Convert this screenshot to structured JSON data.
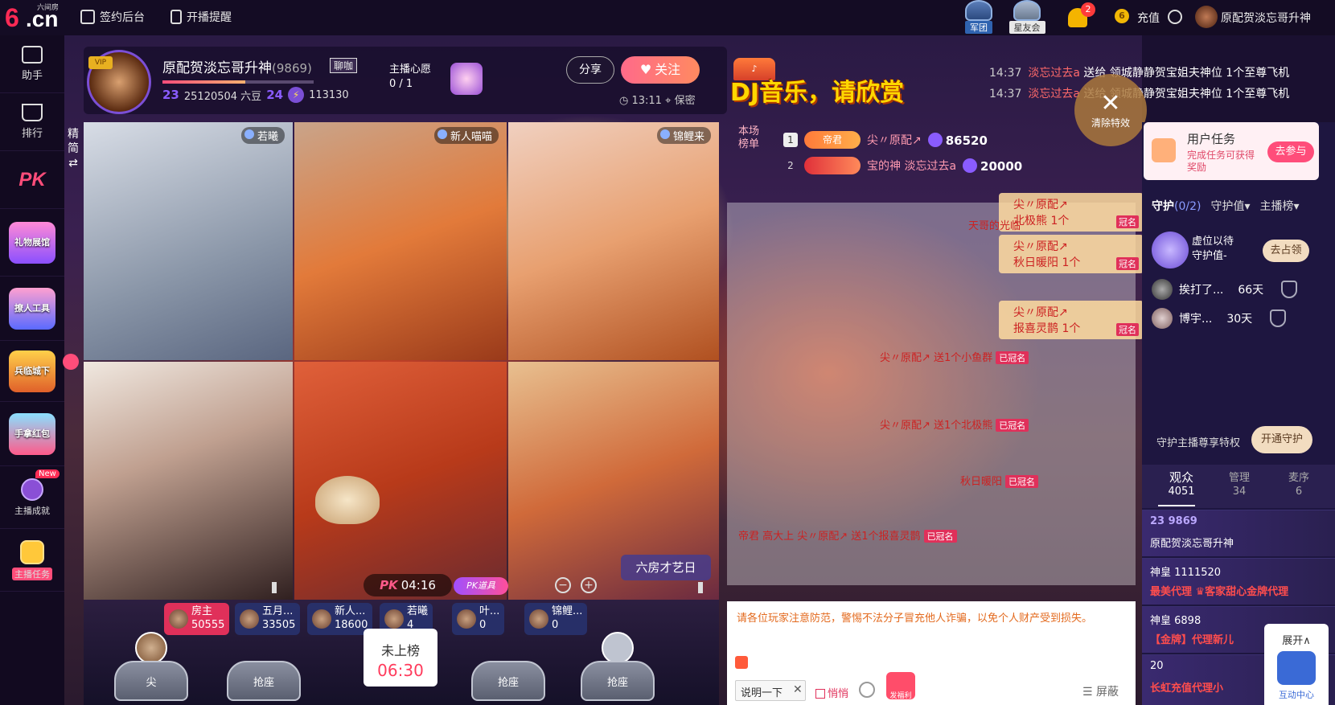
{
  "topbar": {
    "logo_main": "6",
    "logo_cn": ".cn",
    "logo_sub": "六间房",
    "sign_backend": "签约后台",
    "broadcast_reminder": "开播提醒",
    "army": "军团",
    "star_club": "星友会",
    "notification_count": "2",
    "coin_symbol": "6",
    "recharge": "充值",
    "username": "原配贺淡忘哥升神"
  },
  "sidebar": {
    "assistant": "助手",
    "ranking": "排行",
    "pk": "PK",
    "gift_hall": "礼物展馆",
    "tools": "撩人工具",
    "game": "兵临城下",
    "game2": "手拿红包",
    "achievement": "主播成就",
    "achievement_new": "New",
    "task": "主播任务"
  },
  "header": {
    "anchor_name": "原配贺淡忘哥升神",
    "anchor_id": "(9869)",
    "chat_tag": "聊咖",
    "level": "23",
    "beans": "25120504 六豆",
    "level2": "24",
    "points": "113130",
    "level_progress": 0.55,
    "wish_label": "主播心愿",
    "wish_count": "0 / 1",
    "share": "分享",
    "follow": "关注",
    "time": "13:11",
    "privacy": "保密"
  },
  "dj_banner": "DJ音乐，请欣赏",
  "notices": [
    {
      "time": "14:37",
      "user": "淡忘过去a",
      "msg": "送给 领城静静贺宝姐夫神位 1个至尊飞机"
    },
    {
      "time": "14:37",
      "user": "淡忘过去a",
      "msg": "送给 领城静静贺宝姐夫神位 1个至尊飞机"
    }
  ],
  "clear_effects": "清除特效",
  "vertical_tab": "精简",
  "video_cells": [
    {
      "name": "若曦"
    },
    {
      "name": "新人喵喵"
    },
    {
      "name": "锦鲤来"
    }
  ],
  "talent_btn": "六房才艺日",
  "pk_timer_label": "PK",
  "pk_timer": "04:16",
  "pk_tag": "PK道具",
  "ranks": [
    {
      "name": "房主",
      "value": "50555"
    },
    {
      "name": "五月...",
      "value": "33505"
    },
    {
      "name": "新人...",
      "value": "18600"
    },
    {
      "name": "若曦",
      "value": "4"
    },
    {
      "name": "叶...",
      "value": "0"
    },
    {
      "name": "锦鲤...",
      "value": "0"
    }
  ],
  "seats": {
    "seat1": "尖",
    "grab": "抢座",
    "onmic_l1": "未上榜",
    "onmic_l2": "06:30"
  },
  "session_rank": {
    "title": "本场榜单",
    "rows": [
      {
        "num": "1",
        "badge": "帝君",
        "name": "尖〃原配↗",
        "value": "86520"
      },
      {
        "num": "2",
        "badge": "",
        "name": "宝的神 淡忘过去a",
        "value": "20000"
      }
    ]
  },
  "gift_pops": [
    {
      "name": "尖〃原配↗",
      "gift": "北极熊 1个",
      "tag": "冠名"
    },
    {
      "name": "尖〃原配↗",
      "gift": "秋日暖阳 1个",
      "tag": "冠名"
    },
    {
      "name": "尖〃原配↗",
      "gift": "报喜灵鹊 1个",
      "tag": "冠名"
    }
  ],
  "chat_msgs": [
    {
      "text": "天哥的光临"
    },
    {
      "text": "尖〃原配↗ 送1个小鱼群",
      "tag": "已冠名"
    },
    {
      "text": "尖〃原配↗ 送1个北极熊",
      "tag": "已冠名"
    },
    {
      "text": "秋日暖阳",
      "tag": "已冠名"
    },
    {
      "text": "帝君  高大上  尖〃原配↗ 送1个报喜灵鹊",
      "tag": "已冠名"
    }
  ],
  "warning": "请各位玩家注意防范，警惕不法分子冒充他人诈骗，以免个人财产受到损失。",
  "input": {
    "say": "说明一下",
    "whisper": "悄悄",
    "redpack": "发福利",
    "block": "屏蔽"
  },
  "task_card": {
    "title": "用户任务",
    "desc": "完成任务可获得奖励",
    "go": "去参与"
  },
  "guard": {
    "tab_guard": "守护",
    "guard_count": "(0/2)",
    "tab_value": "守护值▾",
    "tab_rank": "主播榜▾",
    "vacant_l1": "虚位以待",
    "vacant_l2": "守护值-",
    "occupy": "去占领",
    "rows": [
      {
        "name": "挨打了...",
        "days": "66天"
      },
      {
        "name": "博宇...",
        "days": "30天"
      }
    ],
    "privilege": "守护主播尊享特权",
    "open": "开通守护"
  },
  "audience": {
    "tab_viewers": "观众",
    "viewers_count": "4051",
    "tab_admin": "管理",
    "admin_count": "34",
    "tab_mai": "麦序",
    "mai_count": "6",
    "items": [
      {
        "l1": "23  9869",
        "l2": "原配贺淡忘哥升神"
      },
      {
        "l1": "神皇  1111520",
        "l2": "最美代理 ♛客家甜心金牌代理"
      },
      {
        "l1": "神皇  6898",
        "l2": "【金牌】代理新儿"
      },
      {
        "l1": "20",
        "l2": "长虹充值代理小"
      }
    ]
  },
  "expand": {
    "label": "展开∧",
    "sub": "互动中心"
  }
}
